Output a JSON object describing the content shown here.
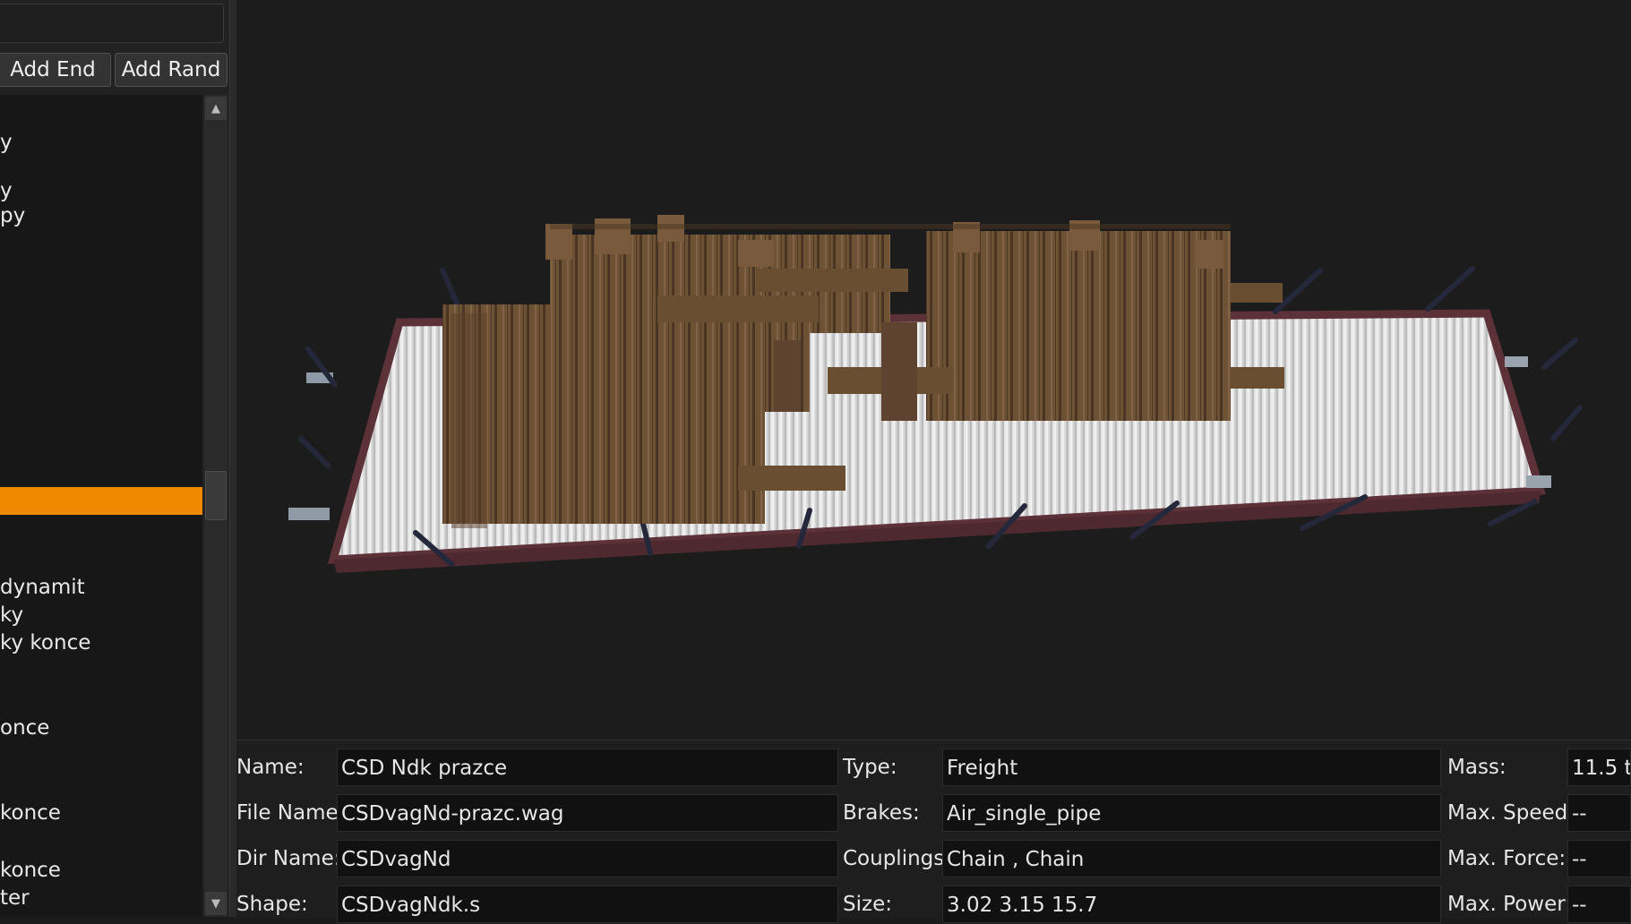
{
  "toolbar": {
    "filter_value": "",
    "add_end_label": "Add End",
    "add_rand_label": "Add Rand"
  },
  "consist_list": {
    "items": [
      {
        "label": "y",
        "selected": false
      },
      {
        "label": "y",
        "selected": false
      },
      {
        "label": "py",
        "selected": false
      },
      {
        "label": "",
        "selected": true
      },
      {
        "label": "dynamit",
        "selected": false
      },
      {
        "label": "ky",
        "selected": false
      },
      {
        "label": "ky konce",
        "selected": false
      },
      {
        "label": "once",
        "selected": false
      },
      {
        "label": "konce",
        "selected": false
      },
      {
        "label": "konce",
        "selected": false
      },
      {
        "label": "ter",
        "selected": false
      }
    ]
  },
  "scrollbar": {
    "up_icon": "▲",
    "down_icon": "▼"
  },
  "viewport": {
    "model": "flat wagon loaded with railway sleepers"
  },
  "properties": {
    "name_label": "Name:",
    "name_value": "CSD Ndk prazce",
    "file_label": "File Name:",
    "file_value": "CSDvagNd-prazc.wag",
    "dir_label": "Dir Name:",
    "dir_value": "CSDvagNd",
    "shape_label": "Shape:",
    "shape_value": "CSDvagNdk.s",
    "type_label": "Type:",
    "type_value": "Freight",
    "brakes_label": "Brakes:",
    "brakes_value": "Air_single_pipe",
    "couplings_label": "Couplings:",
    "couplings_value": "Chain , Chain",
    "size_label": "Size:",
    "size_value": "3.02 3.15 15.7",
    "mass_label": "Mass:",
    "mass_value": "11.5 t",
    "speed_label": "Max. Speed:",
    "speed_value": "--",
    "force_label": "Max. Force:",
    "force_value": "--",
    "power_label": "Max. Power:",
    "power_value": "--"
  },
  "colors": {
    "selection": "#f08800",
    "background": "#1c1c1c",
    "wagon_frame": "#6a3a40",
    "wagon_floor": "#d8d8d8",
    "sleeper_wood": "#6e5236"
  }
}
